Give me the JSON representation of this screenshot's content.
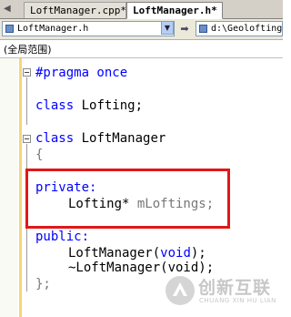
{
  "tabs": [
    {
      "label": "LoftManager.cpp*",
      "active": false
    },
    {
      "label": "LoftManager.h*",
      "active": true
    }
  ],
  "nav": {
    "file_combo": "LoftManager.h",
    "path_combo": "d:\\Geolofting"
  },
  "scope": {
    "label": "(全局范围)"
  },
  "code": {
    "line1_kw": "#pragma once",
    "line2_kw": "class",
    "line2_rest": " Lofting;",
    "line3_kw": "class",
    "line3_rest": " LoftManager",
    "line4": "{",
    "line5_kw": "private:",
    "line6_a": "Lofting* ",
    "line6_b": "mLoftings;",
    "line7_kw": "public:",
    "line8_a": "LoftManager(",
    "line8_kw": "void",
    "line8_b": ");",
    "line9": "~LoftManager(void);",
    "line10": "};"
  },
  "watermark": {
    "brand": "创新互联",
    "sub": "CHUANG XIN HU LIAN"
  },
  "colors": {
    "keyword": "#0000ff",
    "highlight_box": "#e01818",
    "change_bar": "#f5d67a"
  }
}
